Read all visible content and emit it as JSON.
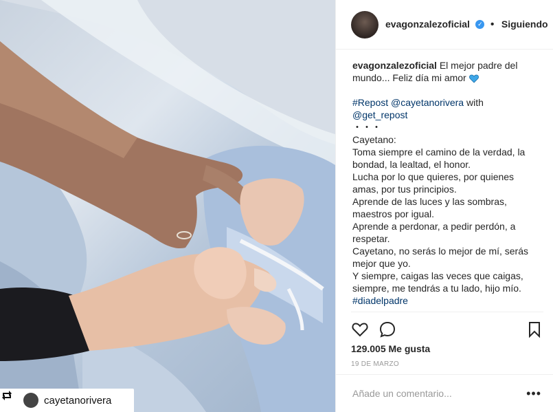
{
  "post": {
    "author": "evagonzalezoficial",
    "verified": true,
    "follow_status": "Siguiendo",
    "separator": "•",
    "caption_line1": "El mejor padre del mundo... Feliz día mi amor",
    "repost_tag": "#Repost @cayetanorivera",
    "repost_with": "with",
    "repost_via": "@get_repost",
    "dots": "・・・",
    "name": "Cayetano:",
    "lines": [
      "Toma siempre el camino de la verdad, la bondad, la lealtad, el honor.",
      "Lucha por lo que quieres, por quienes amas, por tus principios.",
      "Aprende de las luces y las sombras, maestros por igual.",
      "Aprende a perdonar, a pedir perdón, a respetar.",
      "Cayetano, no serás lo mejor de mí, serás mejor que yo.",
      "Y siempre, caigas las veces que caigas, siempre, me tendrás a tu lado, hijo mío."
    ],
    "hashtag": "#diadelpadre",
    "likes": "129.005 Me gusta",
    "date": "19 DE MARZO",
    "comment_placeholder": "Añade un comentario...",
    "more_label": "•••"
  },
  "photo": {
    "repost_user": "cayetanorivera"
  },
  "colors": {
    "link": "#003569",
    "verified": "#3897f0",
    "heart_emoji": "#3897f0"
  },
  "icons": [
    "heart-icon",
    "comment-icon",
    "bookmark-icon",
    "repost-icon",
    "verified-icon",
    "more-options-icon"
  ]
}
